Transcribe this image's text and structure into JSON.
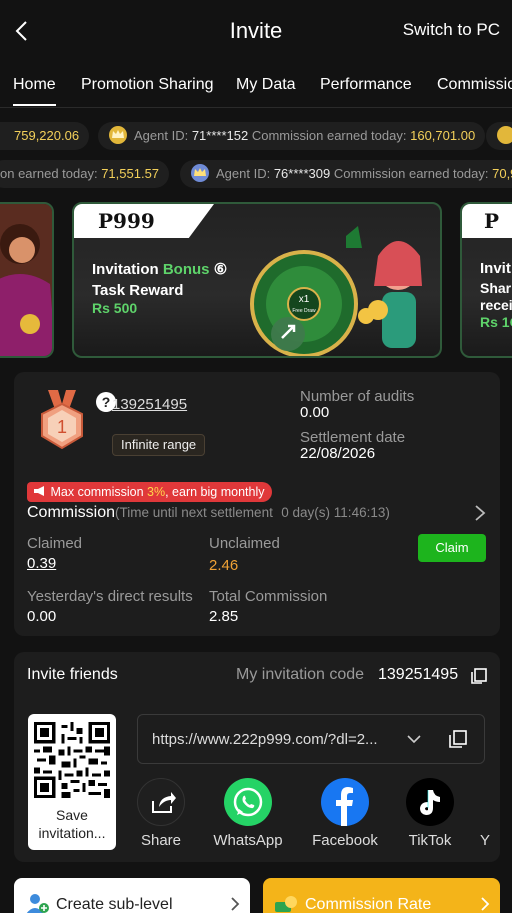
{
  "header": {
    "title": "Invite",
    "switch_label": "Switch to PC"
  },
  "tabs": [
    {
      "label": "Home",
      "active": true
    },
    {
      "label": "Promotion Sharing"
    },
    {
      "label": "My Data"
    },
    {
      "label": "Performance"
    },
    {
      "label": "Commission"
    }
  ],
  "ticker1": [
    {
      "amount": "759,220.06"
    },
    {
      "agent_label": "Agent ID:",
      "agent_id": "71****152",
      "commission_label": "Commission earned today:",
      "amount": "160,701.00"
    }
  ],
  "ticker2": [
    {
      "commission_label": "on earned today:",
      "amount": "71,551.57"
    },
    {
      "agent_label": "Agent ID:",
      "agent_id": "76****309",
      "commission_label": "Commission earned today:",
      "amount": "70,9"
    }
  ],
  "banner": {
    "logo": "P999",
    "line1_a": "Invitation",
    "line1_b": "Bonus",
    "line1_c": "⑥",
    "line2": "Task Reward",
    "amount": "Rs 500",
    "wheel_text": "x1",
    "wheel_sub": "Free Draw",
    "right_logo": "P",
    "right_l1": "Invit",
    "right_l2": "Shar",
    "right_l3": "recei",
    "right_l4": "Rs 1C"
  },
  "commission_card": {
    "rank": "1",
    "agent_id": "139251495",
    "range_label": "Infinite range",
    "audits_label": "Number of audits",
    "audits_value": "0.00",
    "settlement_label": "Settlement date",
    "settlement_value": "22/08/2026",
    "max_a": "Max commission ",
    "max_pct": "3%",
    "max_b": ", earn big monthly",
    "commission_title": "Commission",
    "time_label": "(Time until next settlement",
    "time_value": "0 day(s) 11:46:13)",
    "claimed_label": "Claimed",
    "claimed_value": "0.39",
    "unclaimed_label": "Unclaimed",
    "unclaimed_value": "2.46",
    "claim_button": "Claim",
    "yesterday_label": "Yesterday's direct results",
    "yesterday_value": "0.00",
    "total_label": "Total Commission",
    "total_value": "2.85"
  },
  "invite_card": {
    "title": "Invite friends",
    "code_label": "My invitation code",
    "code_value": "139251495",
    "qr_label": "Save invitation...",
    "link": "https://www.222p999.com/?dl=2...",
    "share_items": [
      {
        "label": "Share",
        "icon": "share-icon",
        "color": "#1f1f1f"
      },
      {
        "label": "WhatsApp",
        "icon": "whatsapp-icon",
        "color": "#25d366"
      },
      {
        "label": "Facebook",
        "icon": "facebook-icon",
        "color": "#1877f2"
      },
      {
        "label": "TikTok",
        "icon": "tiktok-icon",
        "color": "#000000"
      },
      {
        "label": "Y"
      }
    ]
  },
  "bottom": {
    "sub_level": "Create sub-level",
    "rate": "Commission Rate"
  },
  "colors": {
    "accent_green": "#1db41d",
    "gold": "#f3d05a",
    "orange": "#f0a236",
    "red_tag": "#e0383a",
    "rate_button": "#f4b419"
  }
}
